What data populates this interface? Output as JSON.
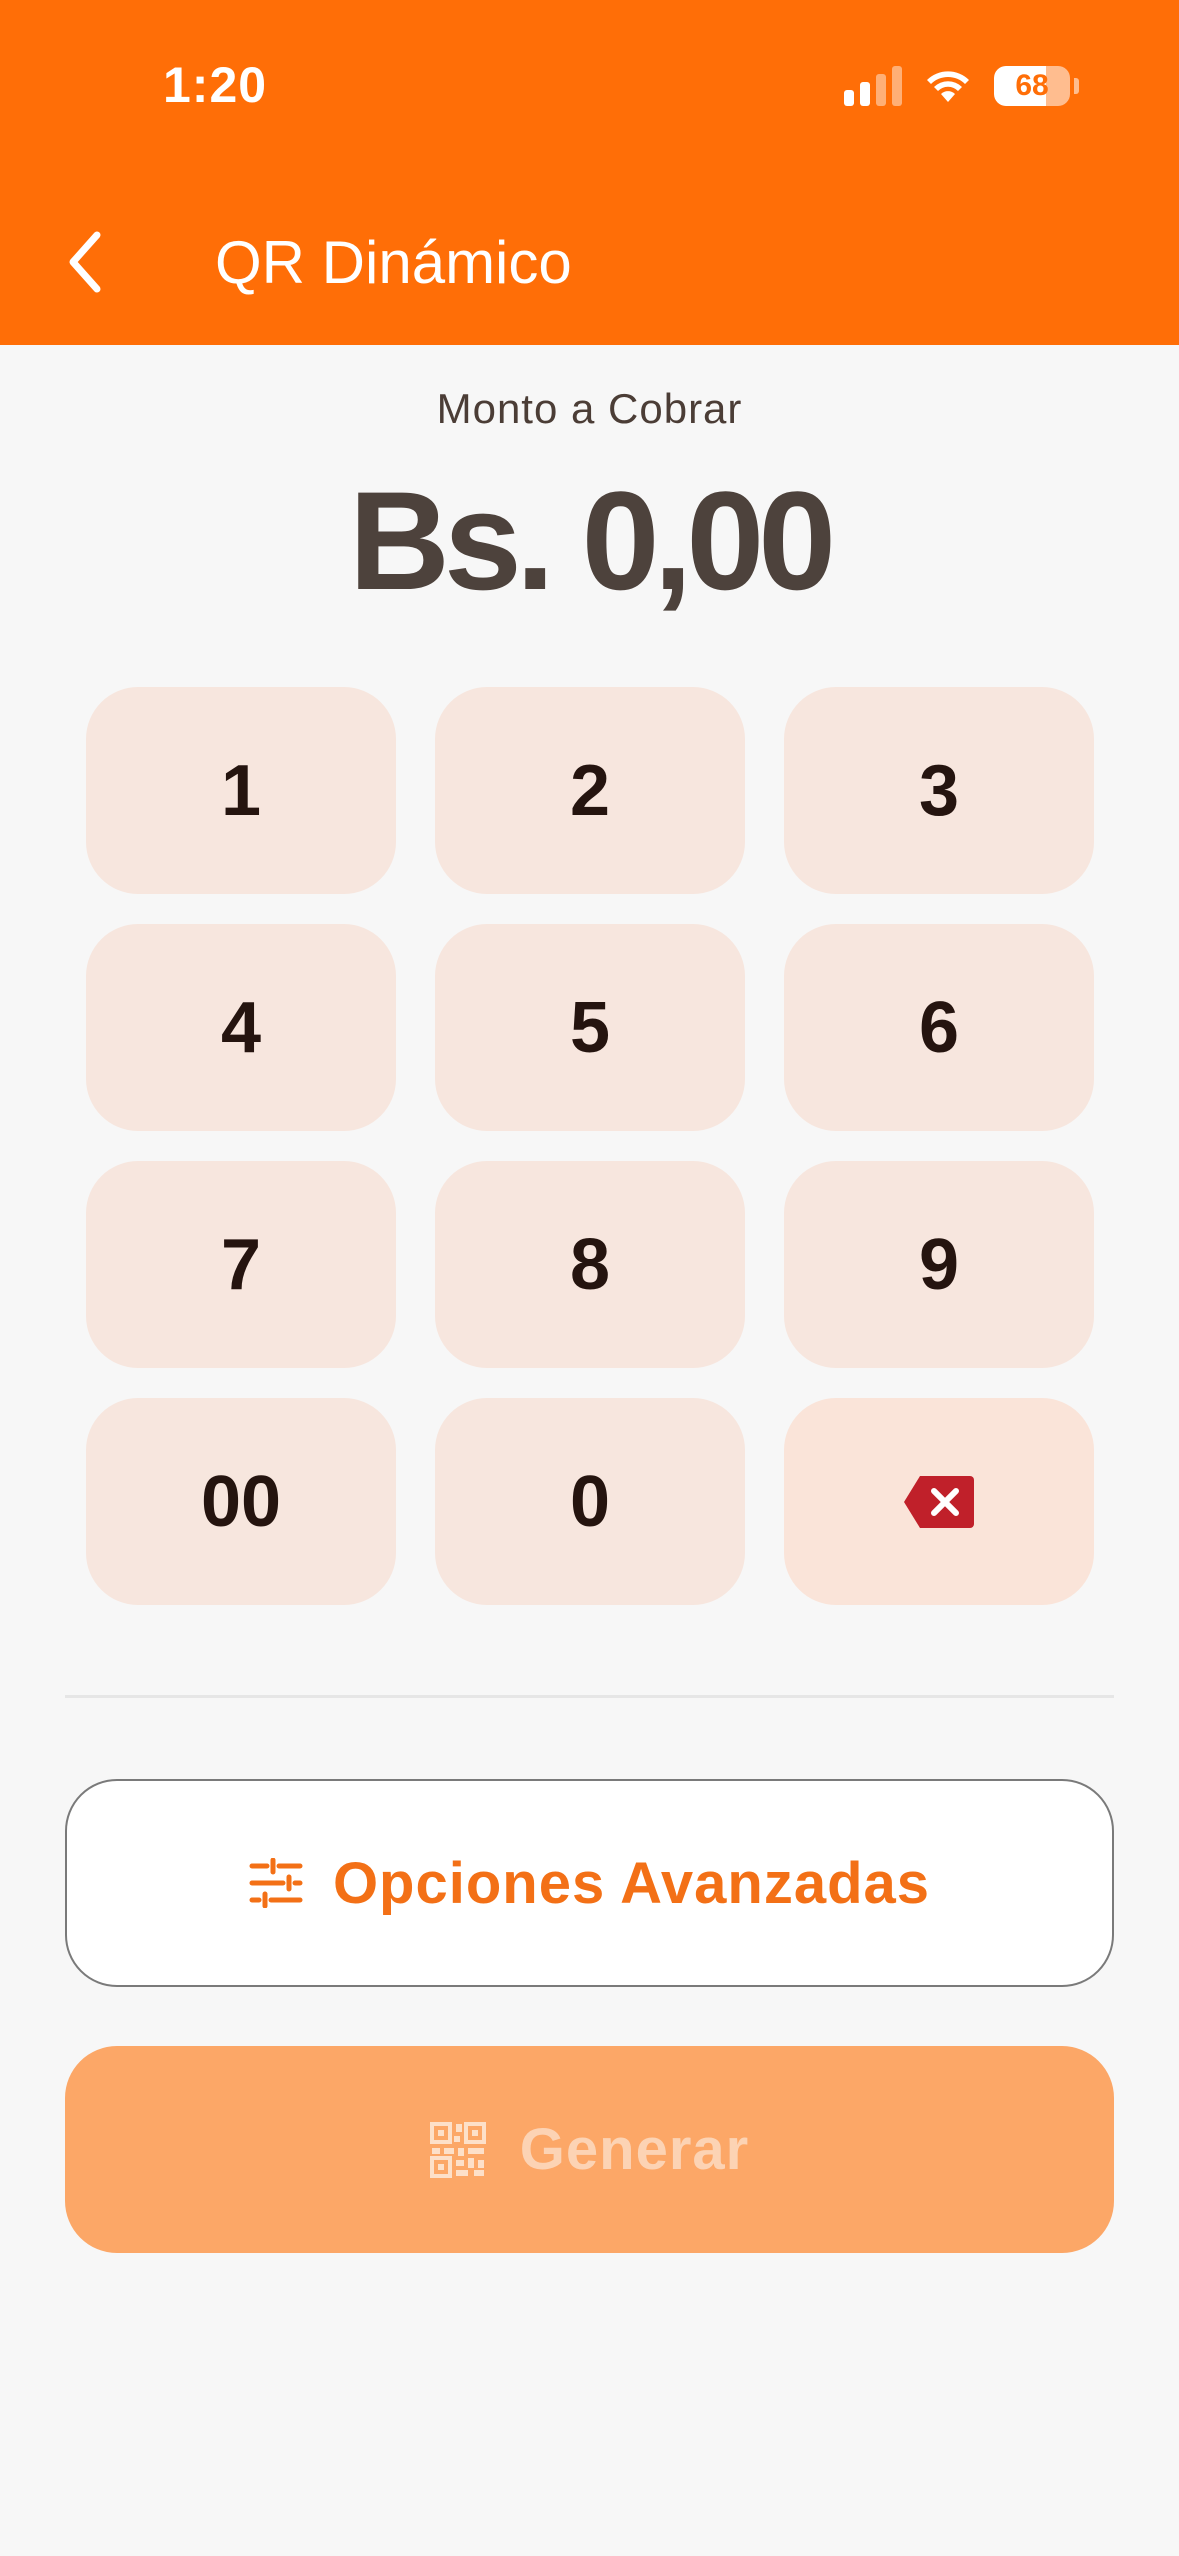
{
  "status_bar": {
    "time": "1:20",
    "battery_percent": "68",
    "battery_level": 0.68,
    "signal_bars": 2,
    "icons": [
      "cellular-signal-icon",
      "wifi-icon",
      "battery-icon"
    ]
  },
  "header": {
    "title": "QR Dinámico",
    "back_icon": "chevron-left-icon",
    "color": "#ff6e07"
  },
  "amount": {
    "label": "Monto a Cobrar",
    "value": "Bs. 0,00"
  },
  "keypad": {
    "keys": [
      "1",
      "2",
      "3",
      "4",
      "5",
      "6",
      "7",
      "8",
      "9",
      "00",
      "0"
    ],
    "delete_icon": "backspace-icon",
    "delete_color": "#c0202a"
  },
  "advanced_button": {
    "label": "Opciones Avanzadas",
    "icon": "sliders-icon",
    "color": "#f37016"
  },
  "generate_button": {
    "label": "Generar",
    "icon": "qr-code-icon",
    "color": "#fca767"
  }
}
